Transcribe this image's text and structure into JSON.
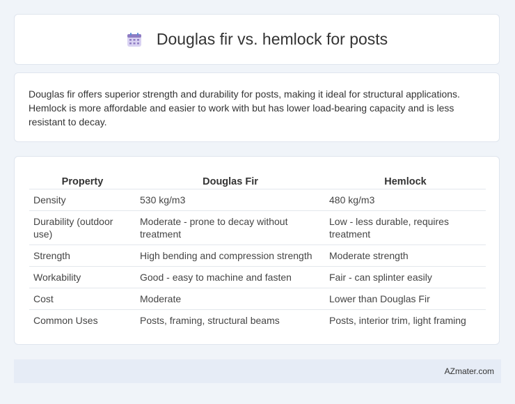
{
  "header": {
    "icon": "calendar-icon",
    "title": "Douglas fir vs. hemlock for posts"
  },
  "intro": {
    "text": "Douglas fir offers superior strength and durability for posts, making it ideal for structural applications. Hemlock is more affordable and easier to work with but has lower load-bearing capacity and is less resistant to decay."
  },
  "table": {
    "headers": [
      "Property",
      "Douglas Fir",
      "Hemlock"
    ],
    "rows": [
      [
        "Density",
        "530 kg/m3",
        "480 kg/m3"
      ],
      [
        "Durability (outdoor use)",
        "Moderate - prone to decay without treatment",
        "Low - less durable, requires treatment"
      ],
      [
        "Strength",
        "High bending and compression strength",
        "Moderate strength"
      ],
      [
        "Workability",
        "Good - easy to machine and fasten",
        "Fair - can splinter easily"
      ],
      [
        "Cost",
        "Moderate",
        "Lower than Douglas Fir"
      ],
      [
        "Common Uses",
        "Posts, framing, structural beams",
        "Posts, interior trim, light framing"
      ]
    ]
  },
  "footer": {
    "brand": "AZmater.com"
  },
  "colors": {
    "background": "#f0f4f9",
    "footer_bg": "#e6ecf6",
    "icon_purple": "#8e7cc3",
    "icon_blue": "#5b8dd6"
  }
}
